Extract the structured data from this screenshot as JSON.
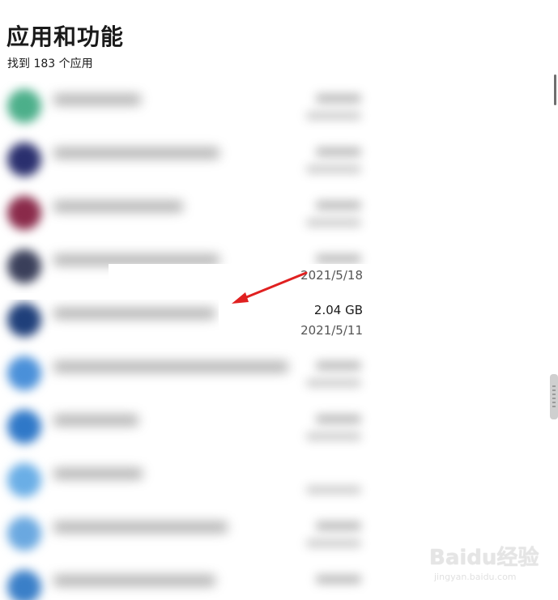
{
  "header": {
    "title": "应用和功能",
    "count_text": "找到 183 个应用"
  },
  "apps": [
    {
      "icon_color": "#4caf8a"
    },
    {
      "icon_color": "#2a2f6e"
    },
    {
      "icon_color": "#8a2a4a"
    },
    {
      "icon_color": "#3a3f5a",
      "date": "2021/5/18"
    },
    {
      "icon_color": "#1f3f7a",
      "size": "2.04 GB",
      "date": "2021/5/11"
    },
    {
      "icon_color": "#4a90d9"
    },
    {
      "icon_color": "#2f78c8"
    },
    {
      "icon_color": "#6aaee6"
    },
    {
      "icon_color": "#6aa8e0"
    },
    {
      "icon_color": "#3a7fc8"
    }
  ],
  "annotation": {
    "arrow_color": "#e02020"
  },
  "watermark": {
    "brand": "Baidu经验",
    "url": "jingyan.baidu.com"
  }
}
